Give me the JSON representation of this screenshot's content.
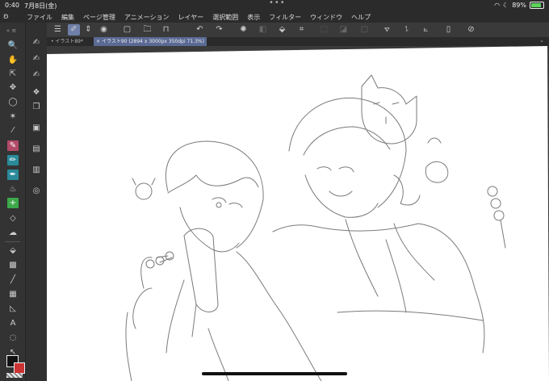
{
  "status_bar": {
    "time": "0:40",
    "date": "7月8日(金)",
    "battery_percent": "89%",
    "wifi_icon": "wifi-icon",
    "moon_icon": "moon-icon"
  },
  "menu": {
    "app_logo_icon": "clip-studio-logo-icon",
    "items": [
      {
        "label": "ファイル"
      },
      {
        "label": "編集"
      },
      {
        "label": "ページ管理"
      },
      {
        "label": "アニメーション"
      },
      {
        "label": "レイヤー"
      },
      {
        "label": "選択範囲"
      },
      {
        "label": "表示"
      },
      {
        "label": "フィルター"
      },
      {
        "label": "ウィンドウ"
      },
      {
        "label": "ヘルプ"
      }
    ]
  },
  "tabs": [
    {
      "label": "イラスト89*",
      "active": false
    },
    {
      "label": "イラスト90 (2894 x 3000px 350dpi 71.3%)",
      "active": true
    }
  ],
  "colors": {
    "accent": "#6e7fa8",
    "main_color": "#111111",
    "sub_color": "#cc3333",
    "canvas": "#ffffff"
  }
}
